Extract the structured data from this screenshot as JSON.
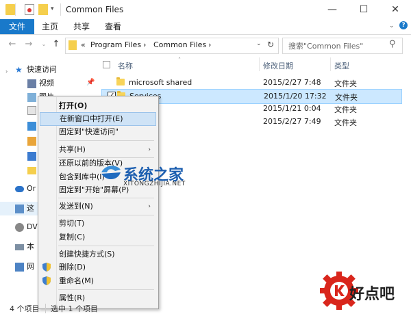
{
  "window": {
    "title": "Common Files",
    "controls": [
      "—",
      "☐",
      "✕"
    ]
  },
  "ribbon": {
    "tabs": [
      "文件",
      "主页",
      "共享",
      "查看"
    ]
  },
  "address": {
    "crumbs": [
      "«",
      "Program Files",
      "›",
      "Common Files",
      "›"
    ],
    "search_placeholder": "搜索\"Common Files\""
  },
  "sidebar": {
    "items": [
      {
        "label": "快速访问",
        "icon": "star-icon"
      },
      {
        "label": "视频",
        "icon": "video-icon"
      },
      {
        "label": "图片",
        "icon": "pictures-icon"
      },
      {
        "label": "",
        "icon": "documents-icon"
      },
      {
        "label": "",
        "icon": "downloads-icon"
      },
      {
        "label": "",
        "icon": "music-icon"
      },
      {
        "label": "",
        "icon": "desktop-icon"
      },
      {
        "label": "",
        "icon": "folder-icon"
      },
      {
        "label": "Or",
        "icon": "onedrive-icon"
      },
      {
        "label": "这",
        "icon": "pc-icon"
      },
      {
        "label": "DV",
        "icon": "dvd-icon"
      },
      {
        "label": "本",
        "icon": "drive-icon"
      },
      {
        "label": "网",
        "icon": "network-icon"
      }
    ]
  },
  "columns": {
    "name": "名称",
    "modified": "修改日期",
    "type": "类型"
  },
  "files": [
    {
      "name": "microsoft shared",
      "modified": "2015/2/27 7:48",
      "type": "文件夹",
      "selected": false
    },
    {
      "name": "Services",
      "modified": "2015/1/20 17:32",
      "type": "文件夹",
      "selected": true
    },
    {
      "name": "",
      "modified": "2015/1/21 0:04",
      "type": "文件夹",
      "selected": false
    },
    {
      "name": "",
      "modified": "2015/2/27 7:49",
      "type": "文件夹",
      "selected": false
    }
  ],
  "menu": {
    "open": "打开(O)",
    "open_new_window": "在新窗口中打开(E)",
    "pin_quick": "固定到\"快速访问\"",
    "share": "共享(H)",
    "restore": "还原以前的版本(V)",
    "include_library": "包含到库中(I)",
    "pin_start": "固定到\"开始\"屏幕(P)",
    "send_to": "发送到(N)",
    "cut": "剪切(T)",
    "copy": "复制(C)",
    "create_shortcut": "创建快捷方式(S)",
    "delete": "删除(D)",
    "rename": "重命名(M)",
    "properties": "属性(R)",
    "submenu_arrow": "›"
  },
  "status": {
    "count": "4 个项目",
    "selected": "选中 1 个项目"
  },
  "watermark": {
    "brand1": "系统之家",
    "url1": "XITONGZHIJIA.NET",
    "brand2": "好点吧"
  },
  "colors": {
    "accent": "#1979ca",
    "selection": "#cce8ff",
    "menu_bg": "#f2f2f2",
    "folder": "#f8d45a",
    "watermark_red": "#d9261c"
  }
}
